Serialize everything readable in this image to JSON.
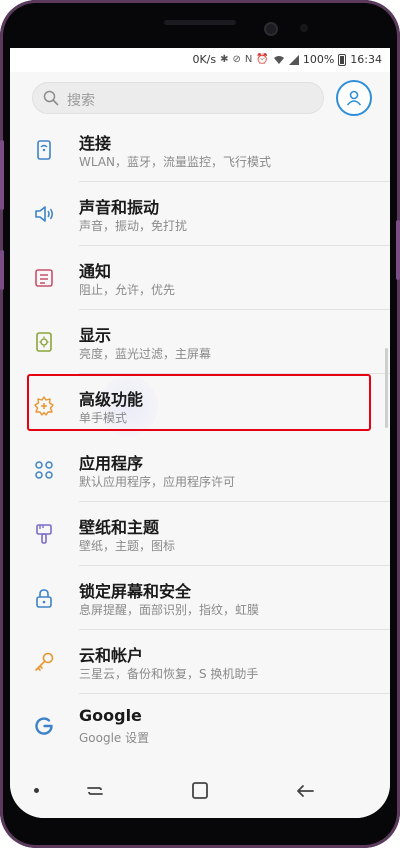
{
  "status_bar": {
    "speed": "0K/s",
    "battery_pct": "100%",
    "time": "16:34",
    "icons": [
      "bluetooth-icon",
      "mute-icon",
      "nfc-icon",
      "alarm-icon",
      "wifi-icon",
      "signal-icon",
      "battery-icon"
    ]
  },
  "search": {
    "placeholder": "搜索",
    "account_icon": "account-icon"
  },
  "settings": [
    {
      "key": "connections",
      "title": "连接",
      "subtitle": "WLAN，蓝牙，流量监控，飞行模式",
      "icon": "connections-icon"
    },
    {
      "key": "sounds",
      "title": "声音和振动",
      "subtitle": "声音，振动，免打扰",
      "icon": "sound-icon"
    },
    {
      "key": "notifications",
      "title": "通知",
      "subtitle": "阻止，允许，优先",
      "icon": "notifications-icon"
    },
    {
      "key": "display",
      "title": "显示",
      "subtitle": "亮度，蓝光过滤，主屏幕",
      "icon": "display-icon"
    },
    {
      "key": "advanced",
      "title": "高级功能",
      "subtitle": "单手模式",
      "icon": "advanced-features-icon",
      "highlighted": true
    },
    {
      "key": "apps",
      "title": "应用程序",
      "subtitle": "默认应用程序，应用程序许可",
      "icon": "apps-icon"
    },
    {
      "key": "wallpapers",
      "title": "壁纸和主题",
      "subtitle": "壁纸，主题，图标",
      "icon": "wallpaper-icon"
    },
    {
      "key": "lock",
      "title": "锁定屏幕和安全",
      "subtitle": "息屏提醒，面部识别，指纹，虹膜",
      "icon": "lock-icon"
    },
    {
      "key": "cloud",
      "title": "云和帐户",
      "subtitle": "三星云，备份和恢复，S 换机助手",
      "icon": "key-icon"
    },
    {
      "key": "google",
      "title": "Google",
      "subtitle": "Google 设置",
      "icon": "google-icon"
    }
  ],
  "navigation": {
    "buttons": [
      "recents-button",
      "home-button",
      "back-button"
    ]
  },
  "colors": {
    "accent_blue": "#2f8fd8",
    "highlight_red": "#e60012",
    "icon_blue": "#3d83c9",
    "icon_orange": "#e8962f",
    "icon_pink": "#c8506a",
    "icon_green": "#8aa53c",
    "icon_purple": "#7b6cc9",
    "frame_purple": "#7b4c86"
  }
}
